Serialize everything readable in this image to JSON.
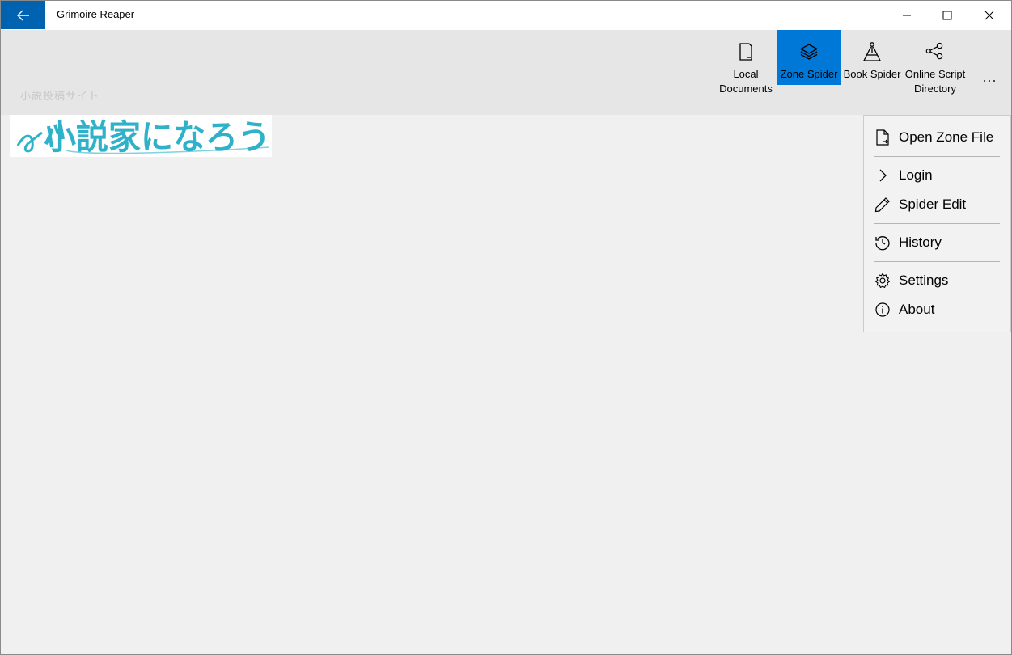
{
  "window": {
    "title": "Grimoire Reaper",
    "controls": {
      "minimize": "minimize-icon",
      "maximize": "maximize-icon",
      "close": "close-icon"
    }
  },
  "commandbar": {
    "faded_text": "小説投稿サイト",
    "buttons": [
      {
        "label": "Local Documents",
        "icon": "document-icon",
        "active": false
      },
      {
        "label": "Zone Spider",
        "icon": "layers-icon",
        "active": true
      },
      {
        "label": "Book Spider",
        "icon": "spider-icon",
        "active": false
      },
      {
        "label": "Online Script Directory",
        "icon": "share-nodes-icon",
        "active": false
      }
    ],
    "more_label": "···"
  },
  "banner": {
    "logo_text": "小説家になろう"
  },
  "menu": {
    "items": [
      {
        "label": "Open Zone File",
        "icon": "file-open-icon"
      },
      {
        "label": "Login",
        "icon": "chevron-right-icon"
      },
      {
        "label": "Spider Edit",
        "icon": "pencil-icon"
      },
      {
        "label": "History",
        "icon": "history-icon"
      },
      {
        "label": "Settings",
        "icon": "gear-icon"
      },
      {
        "label": "About",
        "icon": "info-icon"
      }
    ]
  },
  "colors": {
    "accent": "#0078d7",
    "back_button": "#0063b1",
    "commandbar_bg": "#e6e6e6",
    "content_bg": "#f0f0f0",
    "logo_cyan": "#2fb2c9"
  }
}
